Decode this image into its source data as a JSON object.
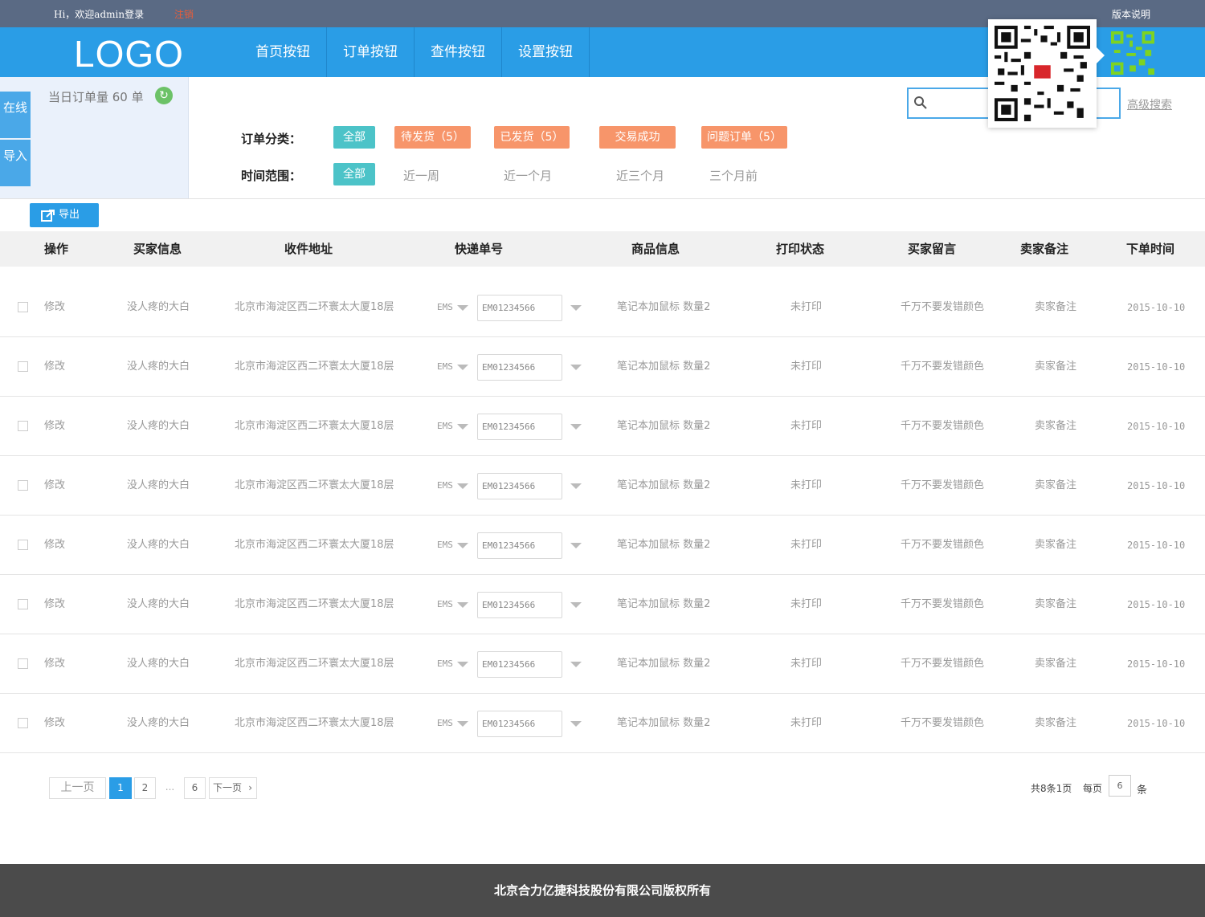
{
  "topbar": {
    "greeting": "Hi，欢迎admin登录",
    "logout": "注销",
    "version": "版本说明"
  },
  "nav": {
    "logo": "LOGO",
    "buttons": [
      "首页按钮",
      "订单按钮",
      "查件按钮",
      "设置按钮"
    ]
  },
  "side": {
    "tabs": [
      "在线",
      "导入"
    ],
    "daily_count": "当日订单量 60 单"
  },
  "filters": {
    "category_label": "订单分类：",
    "categories": [
      "全部",
      "待发货（5）",
      "已发货（5）",
      "交易成功",
      "问题订单（5）"
    ],
    "time_label": "时间范围：",
    "time_ranges": [
      "全部",
      "近一周",
      "近一个月",
      "近三个月",
      "三个月前"
    ]
  },
  "search": {
    "placeholder": "",
    "advanced": "高级搜索"
  },
  "toolbar": {
    "export_label": "导出"
  },
  "table": {
    "headers": [
      "操作",
      "买家信息",
      "收件地址",
      "快递单号",
      "商品信息",
      "打印状态",
      "买家留言",
      "卖家备注",
      "下单时间"
    ],
    "rows": [
      {
        "action": "修改",
        "buyer": "没人疼的大白",
        "address": "北京市海淀区西二环寰太大厦18层",
        "carrier": "EMS",
        "tracking": "EM01234566",
        "goods": "笔记本加鼠标  数量2",
        "print": "未打印",
        "buyer_msg": "千万不要发错颜色",
        "seller_note": "卖家备注",
        "date": "2015-10-10"
      },
      {
        "action": "修改",
        "buyer": "没人疼的大白",
        "address": "北京市海淀区西二环寰太大厦18层",
        "carrier": "EMS",
        "tracking": "EM01234566",
        "goods": "笔记本加鼠标  数量2",
        "print": "未打印",
        "buyer_msg": "千万不要发错颜色",
        "seller_note": "卖家备注",
        "date": "2015-10-10"
      },
      {
        "action": "修改",
        "buyer": "没人疼的大白",
        "address": "北京市海淀区西二环寰太大厦18层",
        "carrier": "EMS",
        "tracking": "EM01234566",
        "goods": "笔记本加鼠标  数量2",
        "print": "未打印",
        "buyer_msg": "千万不要发错颜色",
        "seller_note": "卖家备注",
        "date": "2015-10-10"
      },
      {
        "action": "修改",
        "buyer": "没人疼的大白",
        "address": "北京市海淀区西二环寰太大厦18层",
        "carrier": "EMS",
        "tracking": "EM01234566",
        "goods": "笔记本加鼠标  数量2",
        "print": "未打印",
        "buyer_msg": "千万不要发错颜色",
        "seller_note": "卖家备注",
        "date": "2015-10-10"
      },
      {
        "action": "修改",
        "buyer": "没人疼的大白",
        "address": "北京市海淀区西二环寰太大厦18层",
        "carrier": "EMS",
        "tracking": "EM01234566",
        "goods": "笔记本加鼠标  数量2",
        "print": "未打印",
        "buyer_msg": "千万不要发错颜色",
        "seller_note": "卖家备注",
        "date": "2015-10-10"
      },
      {
        "action": "修改",
        "buyer": "没人疼的大白",
        "address": "北京市海淀区西二环寰太大厦18层",
        "carrier": "EMS",
        "tracking": "EM01234566",
        "goods": "笔记本加鼠标  数量2",
        "print": "未打印",
        "buyer_msg": "千万不要发错颜色",
        "seller_note": "卖家备注",
        "date": "2015-10-10"
      },
      {
        "action": "修改",
        "buyer": "没人疼的大白",
        "address": "北京市海淀区西二环寰太大厦18层",
        "carrier": "EMS",
        "tracking": "EM01234566",
        "goods": "笔记本加鼠标  数量2",
        "print": "未打印",
        "buyer_msg": "千万不要发错颜色",
        "seller_note": "卖家备注",
        "date": "2015-10-10"
      },
      {
        "action": "修改",
        "buyer": "没人疼的大白",
        "address": "北京市海淀区西二环寰太大厦18层",
        "carrier": "EMS",
        "tracking": "EM01234566",
        "goods": "笔记本加鼠标  数量2",
        "print": "未打印",
        "buyer_msg": "千万不要发错颜色",
        "seller_note": "卖家备注",
        "date": "2015-10-10"
      }
    ]
  },
  "pagination": {
    "prev": "上一页",
    "pages": [
      "1",
      "2",
      "...",
      "6"
    ],
    "next": "下一页",
    "total": "共8条1页",
    "per_page_label": "每页",
    "per_page": "6",
    "unit": "条"
  },
  "footer": {
    "copyright": "北京合力亿捷科技股份有限公司版权所有"
  },
  "colors": {
    "topbar": "#5a6a84",
    "nav": "#2a9de6",
    "teal": "#4cc3c8",
    "orange": "#f7956a",
    "footer": "#4b4b4b"
  },
  "icons": [
    "qr-code-icon",
    "search-icon",
    "refresh-icon",
    "export-icon",
    "chevron-right-icon"
  ]
}
